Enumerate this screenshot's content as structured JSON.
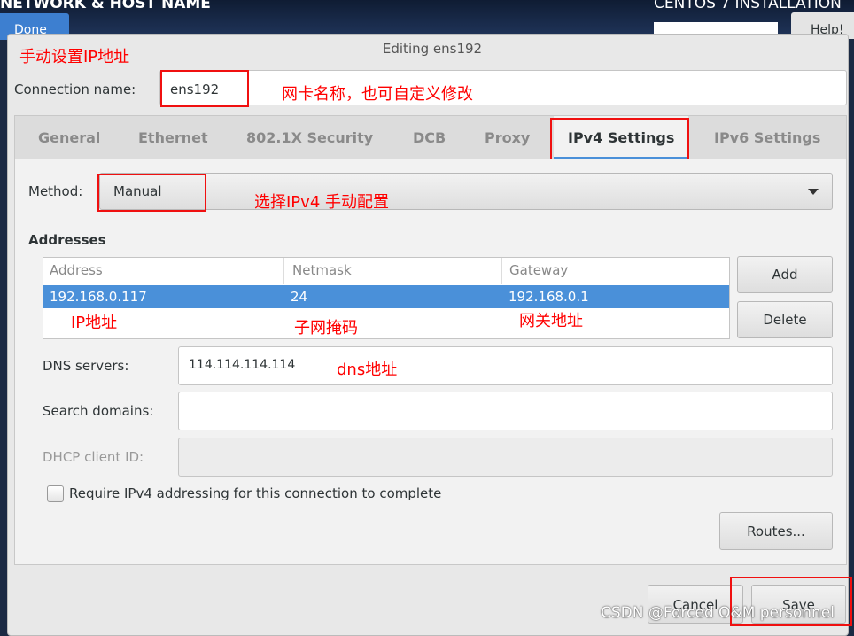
{
  "background": {
    "title": "NETWORK & HOST NAME",
    "installer": "CENTOS 7 INSTALLATION",
    "done_label": "Done",
    "help_label": "Help!"
  },
  "dialog": {
    "title": "Editing ens192",
    "connection_name_label": "Connection name:",
    "connection_name_value": "ens192",
    "tabs": [
      {
        "label": "General"
      },
      {
        "label": "Ethernet"
      },
      {
        "label": "802.1X Security"
      },
      {
        "label": "DCB"
      },
      {
        "label": "Proxy"
      },
      {
        "label": "IPv4 Settings",
        "active": true
      },
      {
        "label": "IPv6 Settings"
      }
    ],
    "method_label": "Method:",
    "method_value": "Manual",
    "addresses_label": "Addresses",
    "table": {
      "columns": [
        "Address",
        "Netmask",
        "Gateway"
      ],
      "rows": [
        [
          "192.168.0.117",
          "24",
          "192.168.0.1"
        ]
      ]
    },
    "add_label": "Add",
    "delete_label": "Delete",
    "dns_label": "DNS servers:",
    "dns_value": "114.114.114.114",
    "search_label": "Search domains:",
    "search_value": "",
    "dhcp_label": "DHCP client ID:",
    "dhcp_value": "",
    "require_label": "Require IPv4 addressing for this connection to complete",
    "require_checked": false,
    "routes_label": "Routes...",
    "cancel_label": "Cancel",
    "save_label": "Save"
  },
  "annotations": {
    "manual_ip": "手动设置IP地址",
    "nic_name": "网卡名称，也可自定义修改",
    "ipv4_manual": "选择IPv4 手动配置",
    "ip": "IP地址",
    "netmask": "子网掩码",
    "gateway": "网关地址",
    "dns": "dns地址",
    "color": "#ff0000"
  },
  "watermark": "CSDN @Forced O&M personnel"
}
